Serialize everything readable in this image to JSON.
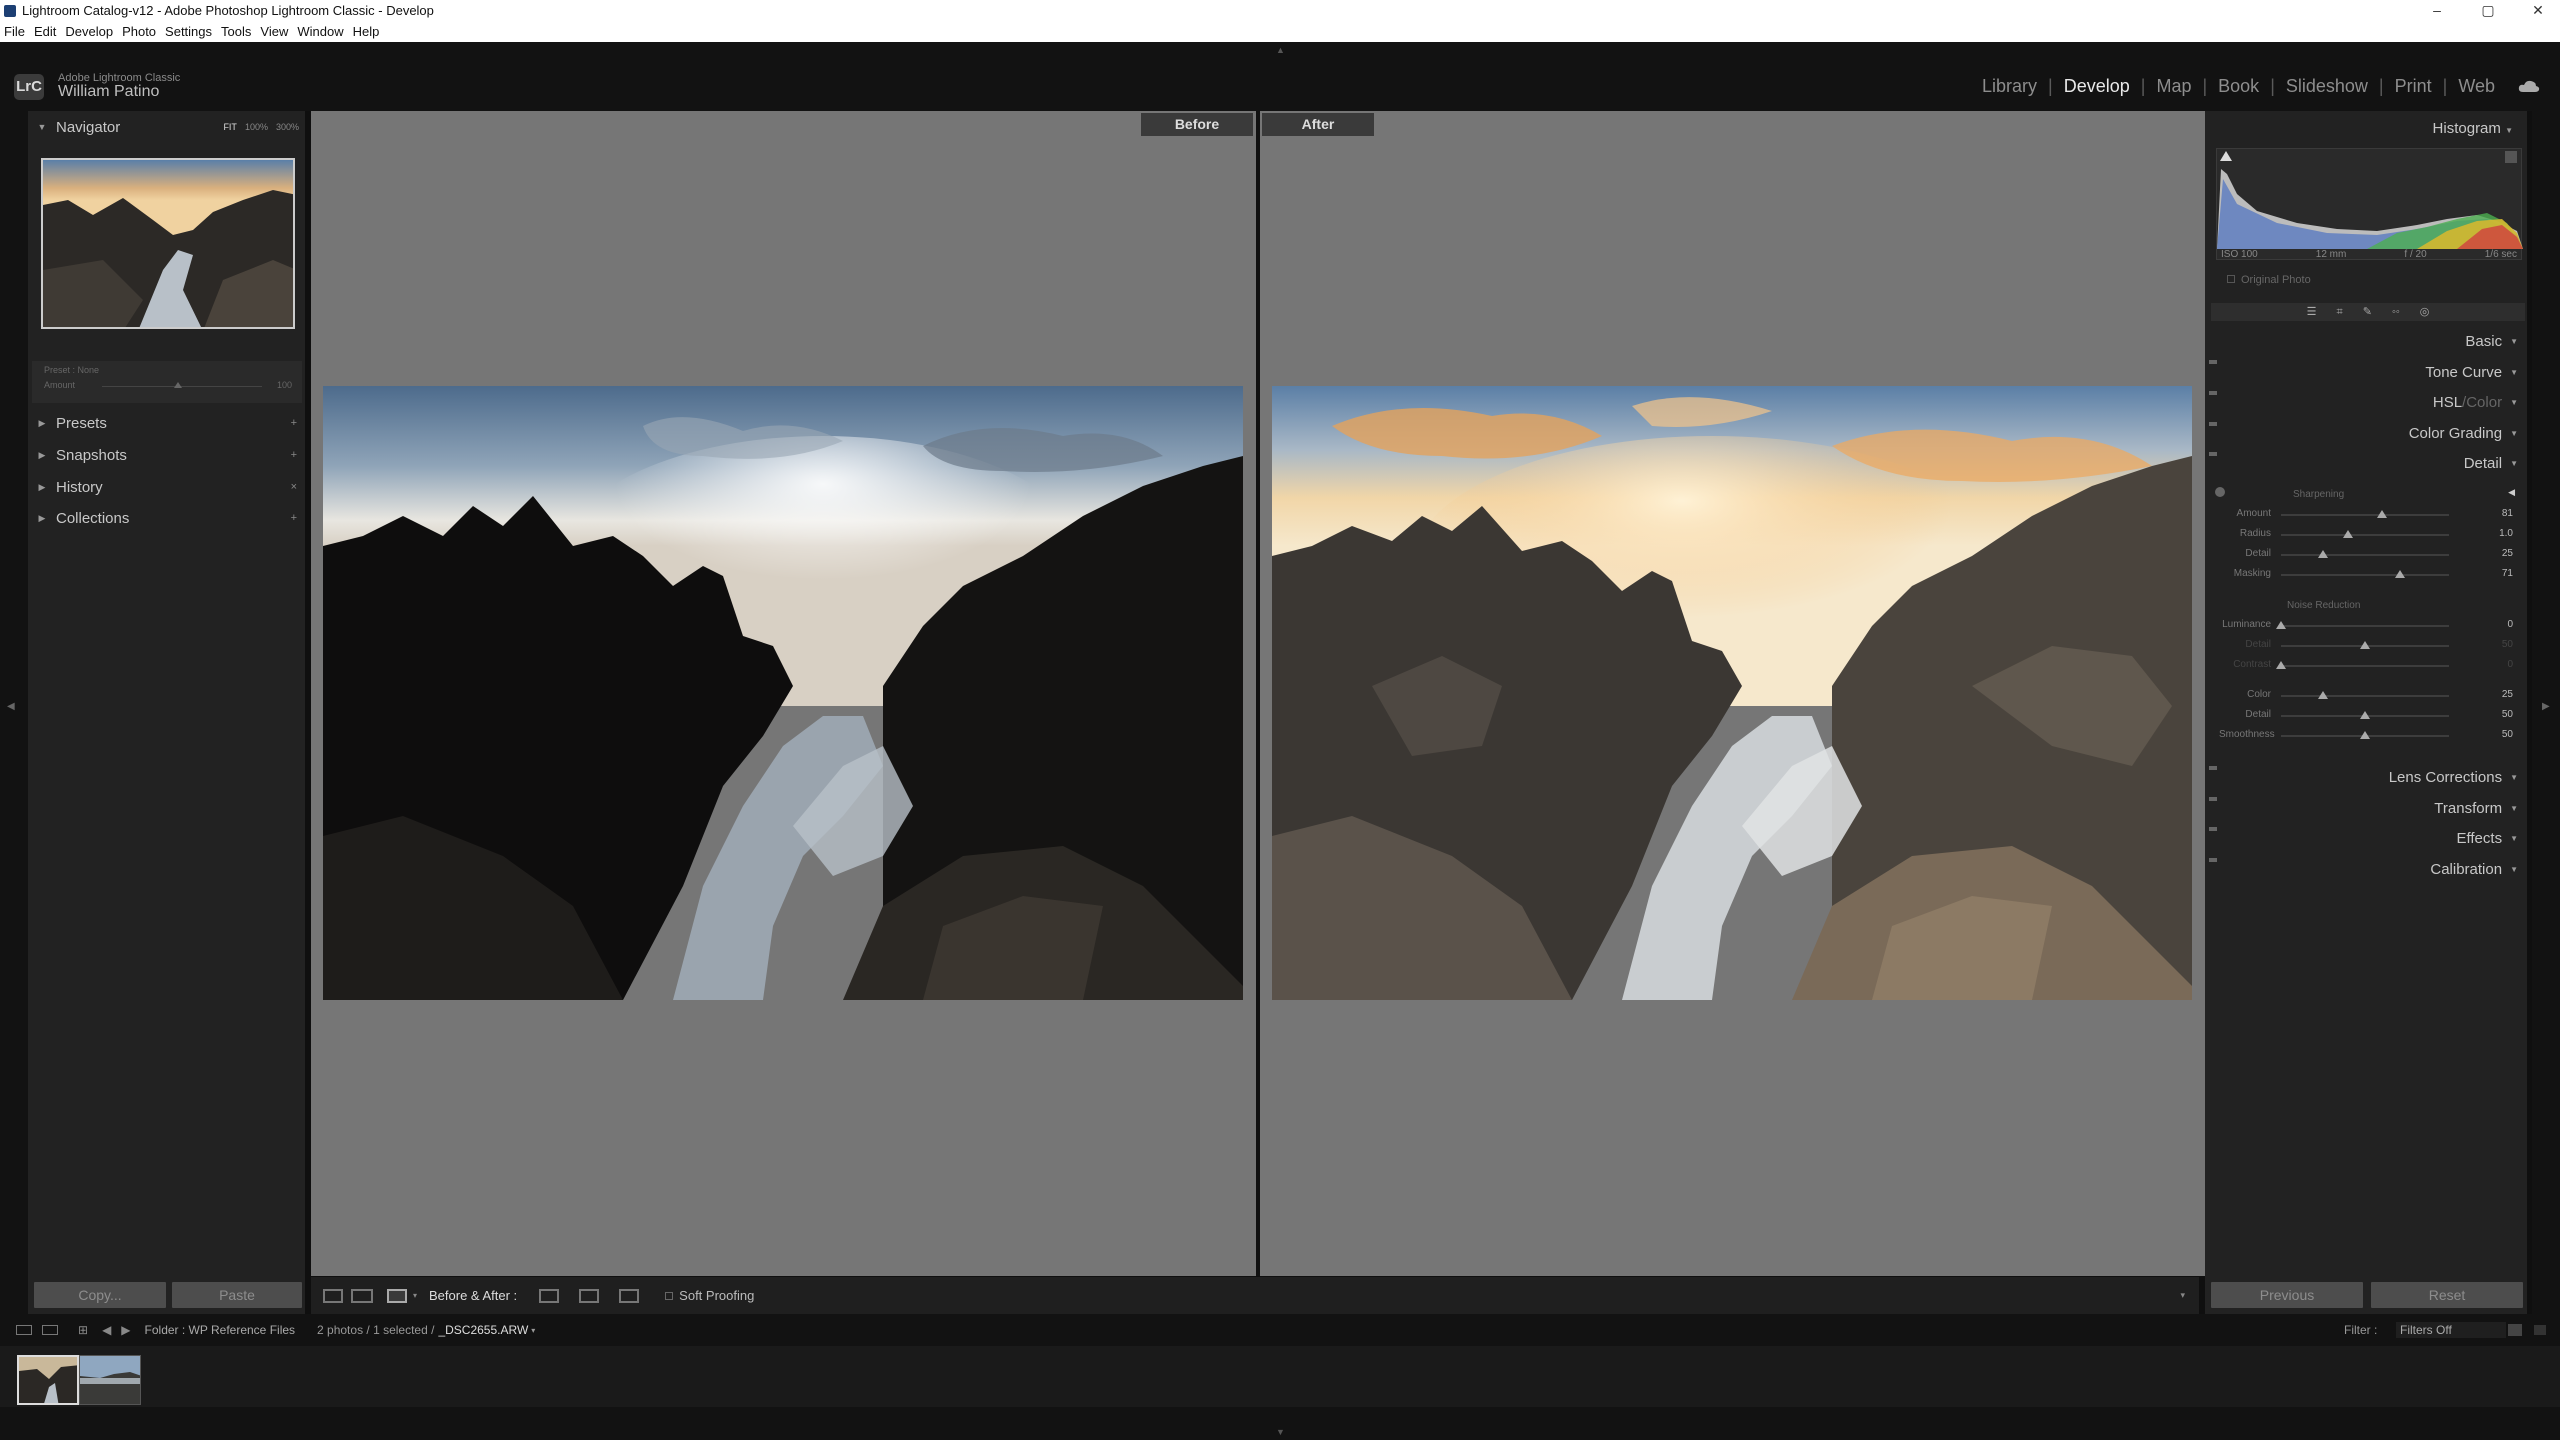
{
  "window": {
    "title": "Lightroom Catalog-v12 - Adobe Photoshop Lightroom Classic - Develop",
    "controls": [
      "–",
      "▢",
      "✕"
    ]
  },
  "menu": [
    "File",
    "Edit",
    "Develop",
    "Photo",
    "Settings",
    "Tools",
    "View",
    "Window",
    "Help"
  ],
  "identity": {
    "badge": "LrC",
    "product": "Adobe Lightroom Classic",
    "user": "William Patino"
  },
  "modules": {
    "items": [
      "Library",
      "Develop",
      "Map",
      "Book",
      "Slideshow",
      "Print",
      "Web"
    ],
    "active": "Develop"
  },
  "left_panel": {
    "navigator": {
      "title": "Navigator",
      "zoom": [
        "FIT",
        "100%",
        "300%"
      ]
    },
    "preset_row": {
      "label": "Preset : None",
      "amount_label": "Amount",
      "amount_value": "100"
    },
    "sections": [
      "Presets",
      "Snapshots",
      "History",
      "Collections"
    ],
    "copy": "Copy...",
    "paste": "Paste"
  },
  "center": {
    "before_label": "Before",
    "after_label": "After"
  },
  "toolbar": {
    "view_label": "Before & After :",
    "soft_proofing": "Soft Proofing"
  },
  "right_panel": {
    "histogram_title": "Histogram",
    "exif": [
      "ISO 100",
      "12 mm",
      "f / 20",
      "1/6 sec"
    ],
    "original_photo": "Original Photo",
    "sections": {
      "basic": "Basic",
      "tone_curve": "Tone Curve",
      "hsl": "HSL",
      "hsl_sep": " / ",
      "color": "Color",
      "color_grading": "Color Grading",
      "detail": "Detail",
      "lens": "Lens Corrections",
      "transform": "Transform",
      "effects": "Effects",
      "calibration": "Calibration"
    },
    "sharpening": {
      "title": "Sharpening",
      "sliders": [
        {
          "label": "Amount",
          "value": "81",
          "level": 0.6
        },
        {
          "label": "Radius",
          "value": "1.0",
          "level": 0.4
        },
        {
          "label": "Detail",
          "value": "25",
          "level": 0.25
        },
        {
          "label": "Masking",
          "value": "71",
          "level": 0.71
        }
      ]
    },
    "noise_reduction": {
      "title": "Noise Reduction",
      "sliders": [
        {
          "label": "Luminance",
          "value": "0",
          "level": 0.0,
          "dim": false
        },
        {
          "label": "Detail",
          "value": "50",
          "level": 0.5,
          "dim": true
        },
        {
          "label": "Contrast",
          "value": "0",
          "level": 0.0,
          "dim": true
        },
        {
          "label": "Color",
          "value": "25",
          "level": 0.25,
          "dim": false
        },
        {
          "label": "Detail",
          "value": "50",
          "level": 0.5,
          "dim": false
        },
        {
          "label": "Smoothness",
          "value": "50",
          "level": 0.5,
          "dim": false
        }
      ]
    },
    "previous": "Previous",
    "reset": "Reset"
  },
  "filmstrip_bar": {
    "folder": "Folder : WP Reference Files",
    "count": "2 photos / 1 selected /",
    "file": "_DSC2655.ARW",
    "filter_label": "Filter :",
    "filter_value": "Filters Off"
  }
}
